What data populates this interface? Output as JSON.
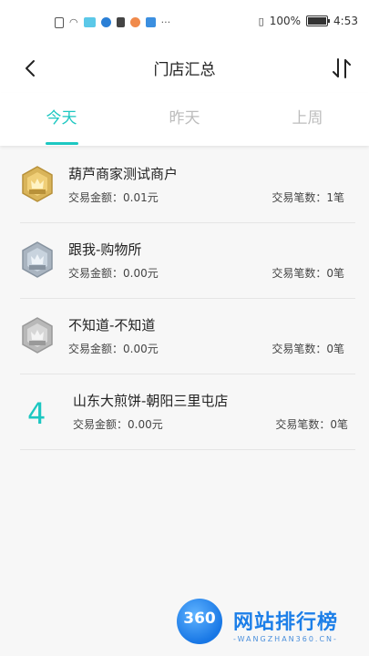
{
  "status_bar": {
    "battery_percent": "100%",
    "time": "4:53"
  },
  "nav": {
    "title": "门店汇总",
    "back_icon": "chevron-left-icon",
    "sort_icon": "sort-arrows-icon"
  },
  "tabs": [
    {
      "label": "今天",
      "active": true
    },
    {
      "label": "昨天",
      "active": false
    },
    {
      "label": "上周",
      "active": false
    }
  ],
  "stores": [
    {
      "medal": "gold-medal-icon",
      "name": "葫芦商家测试商户",
      "amount": "交易金额：0.01元",
      "count": "交易笔数：1笔"
    },
    {
      "medal": "silver-medal-icon",
      "name": "跟我-购物所",
      "amount": "交易金额：0.00元",
      "count": "交易笔数：0笔"
    },
    {
      "medal": "bronze-medal-icon",
      "name": "不知道-不知道",
      "amount": "交易金额：0.00元",
      "count": "交易笔数：0笔"
    },
    {
      "rank": "4",
      "name": "山东大煎饼-朝阳三里屯店",
      "amount": "交易金额：0.00元",
      "count": "交易笔数：0笔"
    }
  ],
  "watermark": {
    "logo_text": "360",
    "title": "网站排行榜",
    "subtitle": "-WANGZHAN360.CN-"
  },
  "colors": {
    "accent": "#1cc7c1",
    "tab_inactive": "#bcbcbc",
    "watermark_blue": "#1d7fe8"
  }
}
